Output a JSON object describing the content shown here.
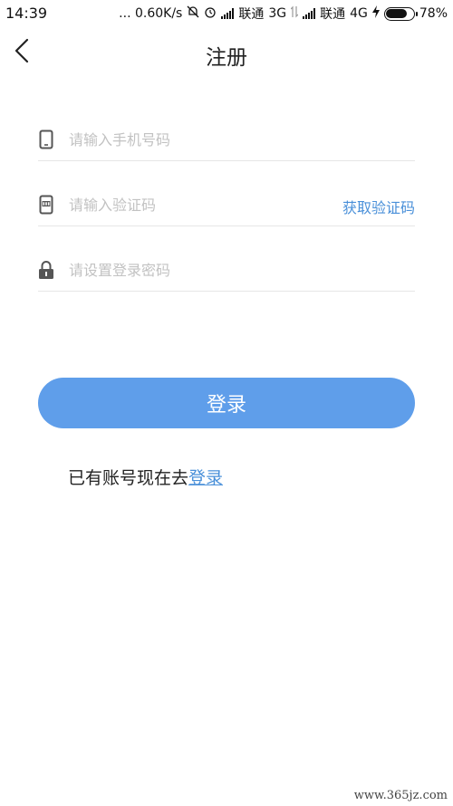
{
  "status_bar": {
    "time": "14:39",
    "network_speed": "... 0.60K/s",
    "carrier1": "联通",
    "network1": "3G",
    "carrier2": "联通",
    "network2": "4G",
    "battery_percent": "78%",
    "battery_level": 0.78
  },
  "header": {
    "title": "注册",
    "back_icon": "chevron-left-icon"
  },
  "form": {
    "phone": {
      "icon": "phone-icon",
      "placeholder": "请输入手机号码",
      "value": ""
    },
    "code": {
      "icon": "sms-code-icon",
      "placeholder": "请输入验证码",
      "value": "",
      "get_code_label": "获取验证码"
    },
    "password": {
      "icon": "lock-icon",
      "placeholder": "请设置登录密码",
      "value": ""
    }
  },
  "login_button": {
    "label": "登录",
    "color": "#5f9eea"
  },
  "footer": {
    "prompt": "已有账号现在去",
    "link_label": "登录",
    "link_color": "#4a90d9"
  },
  "watermark": "www.365jz.com"
}
